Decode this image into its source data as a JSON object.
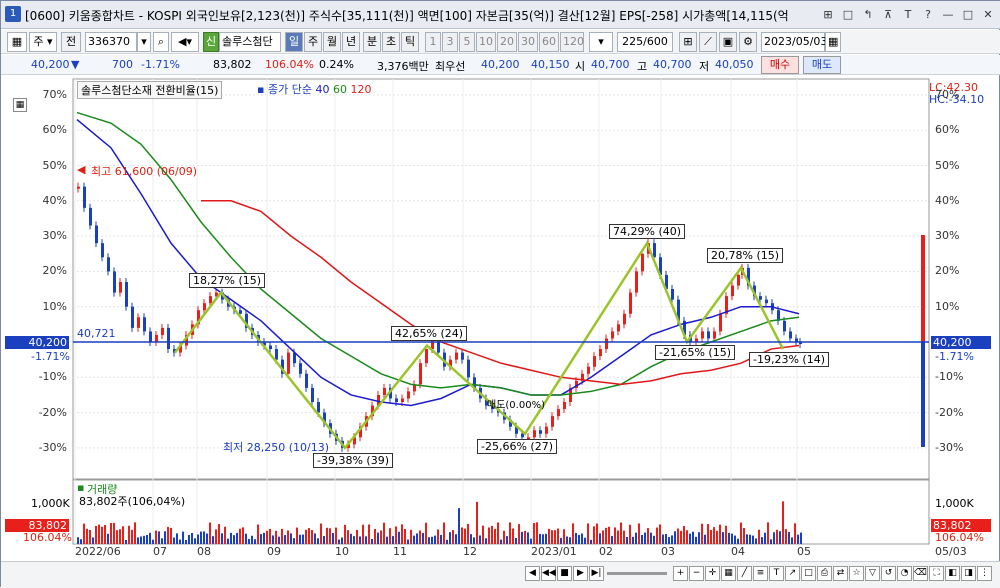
{
  "title": {
    "badge": "1",
    "text": "[0600] 키움종합차트 - KOSPI 외국인보유[2,123(천)] 주식수[35,111(천)] 액면[100] 자본금[35(억)] 결산[12월] EPS[-258] 시가총액[14,115(억"
  },
  "window_buttons": [
    "⊞",
    "□",
    "↰",
    "⊼",
    "T",
    "?",
    "—",
    "□",
    "✕"
  ],
  "toolbar": {
    "market": "주",
    "prev": "전",
    "code": "336370",
    "stock_name_badge": "신",
    "stock_name": "솔루스첨단",
    "periods": [
      "일",
      "주",
      "월",
      "년",
      "분",
      "초",
      "틱"
    ],
    "intervals": [
      "1",
      "3",
      "5",
      "10",
      "20",
      "30",
      "60",
      "120"
    ],
    "count": "225",
    "count_total": "/600",
    "date": "2023/05/03"
  },
  "infobar": {
    "price": "40,200",
    "arrow": "▼",
    "change": "700",
    "change_pct": "-1.71%",
    "volume": "83,802",
    "volume_ratio": "106.04%",
    "turnover": "0.24%",
    "amount": "3,376백만",
    "best_label": "최우선",
    "ask": "40,200",
    "bid": "40,150",
    "open_label": "시",
    "open": "40,700",
    "high_label": "고",
    "high": "40,700",
    "low_label": "저",
    "low": "40,050",
    "buy": "매수",
    "sell": "매도"
  },
  "legend": {
    "main": "솔루스첨단소재 전환비율(15)",
    "ma_label": "종가 단순",
    "ma1": "40",
    "ma2": "60",
    "ma3": "120"
  },
  "right_top": {
    "lc": "LC:42.30",
    "hc": "HC:-34.10"
  },
  "y_axis": [
    "70%",
    "60%",
    "50%",
    "40%",
    "30%",
    "20%",
    "10%",
    "0%",
    "-10%",
    "-20%",
    "-30%"
  ],
  "y_axis_right": [
    "70%",
    "60%",
    "50%",
    "40%",
    "30%",
    "20%",
    "10%",
    "0%",
    "-10%",
    "-20%",
    "-30%"
  ],
  "current": {
    "price": "40,200",
    "pct": "-1.71%",
    "ref": "40,721"
  },
  "annotations": {
    "high": "최고 61,600 (06/09)",
    "low": "최저 28,250 (10/13)",
    "zz1": "18,27% (15)",
    "zz2": "-39,38% (39)",
    "zz3": "42,65% (24)",
    "zz4": "-25,66% (27)",
    "zz5": "74,29% (40)",
    "zz6": "-21,65% (15)",
    "zz7": "20,78% (15)",
    "zz8": "-19,23% (14)",
    "mid": "매도(0.00%)"
  },
  "volume_panel": {
    "label": "거래량",
    "value": "83,802주(106,04%)",
    "axis": "1,000K",
    "last": "83,802",
    "last_pct": "106.04%"
  },
  "x_axis": [
    "2022/06",
    "07",
    "08",
    "09",
    "10",
    "11",
    "12",
    "2023/01",
    "02",
    "03",
    "04",
    "05"
  ],
  "x_axis_right": "05/03",
  "colors": {
    "up": "#e8201c",
    "down": "#1a3fbf",
    "ma40": "#1a1ad0",
    "ma60": "#1a8a1a",
    "ma120": "#e01818",
    "zigzag": "#9bc42a",
    "current": "#1a3fbf"
  }
}
